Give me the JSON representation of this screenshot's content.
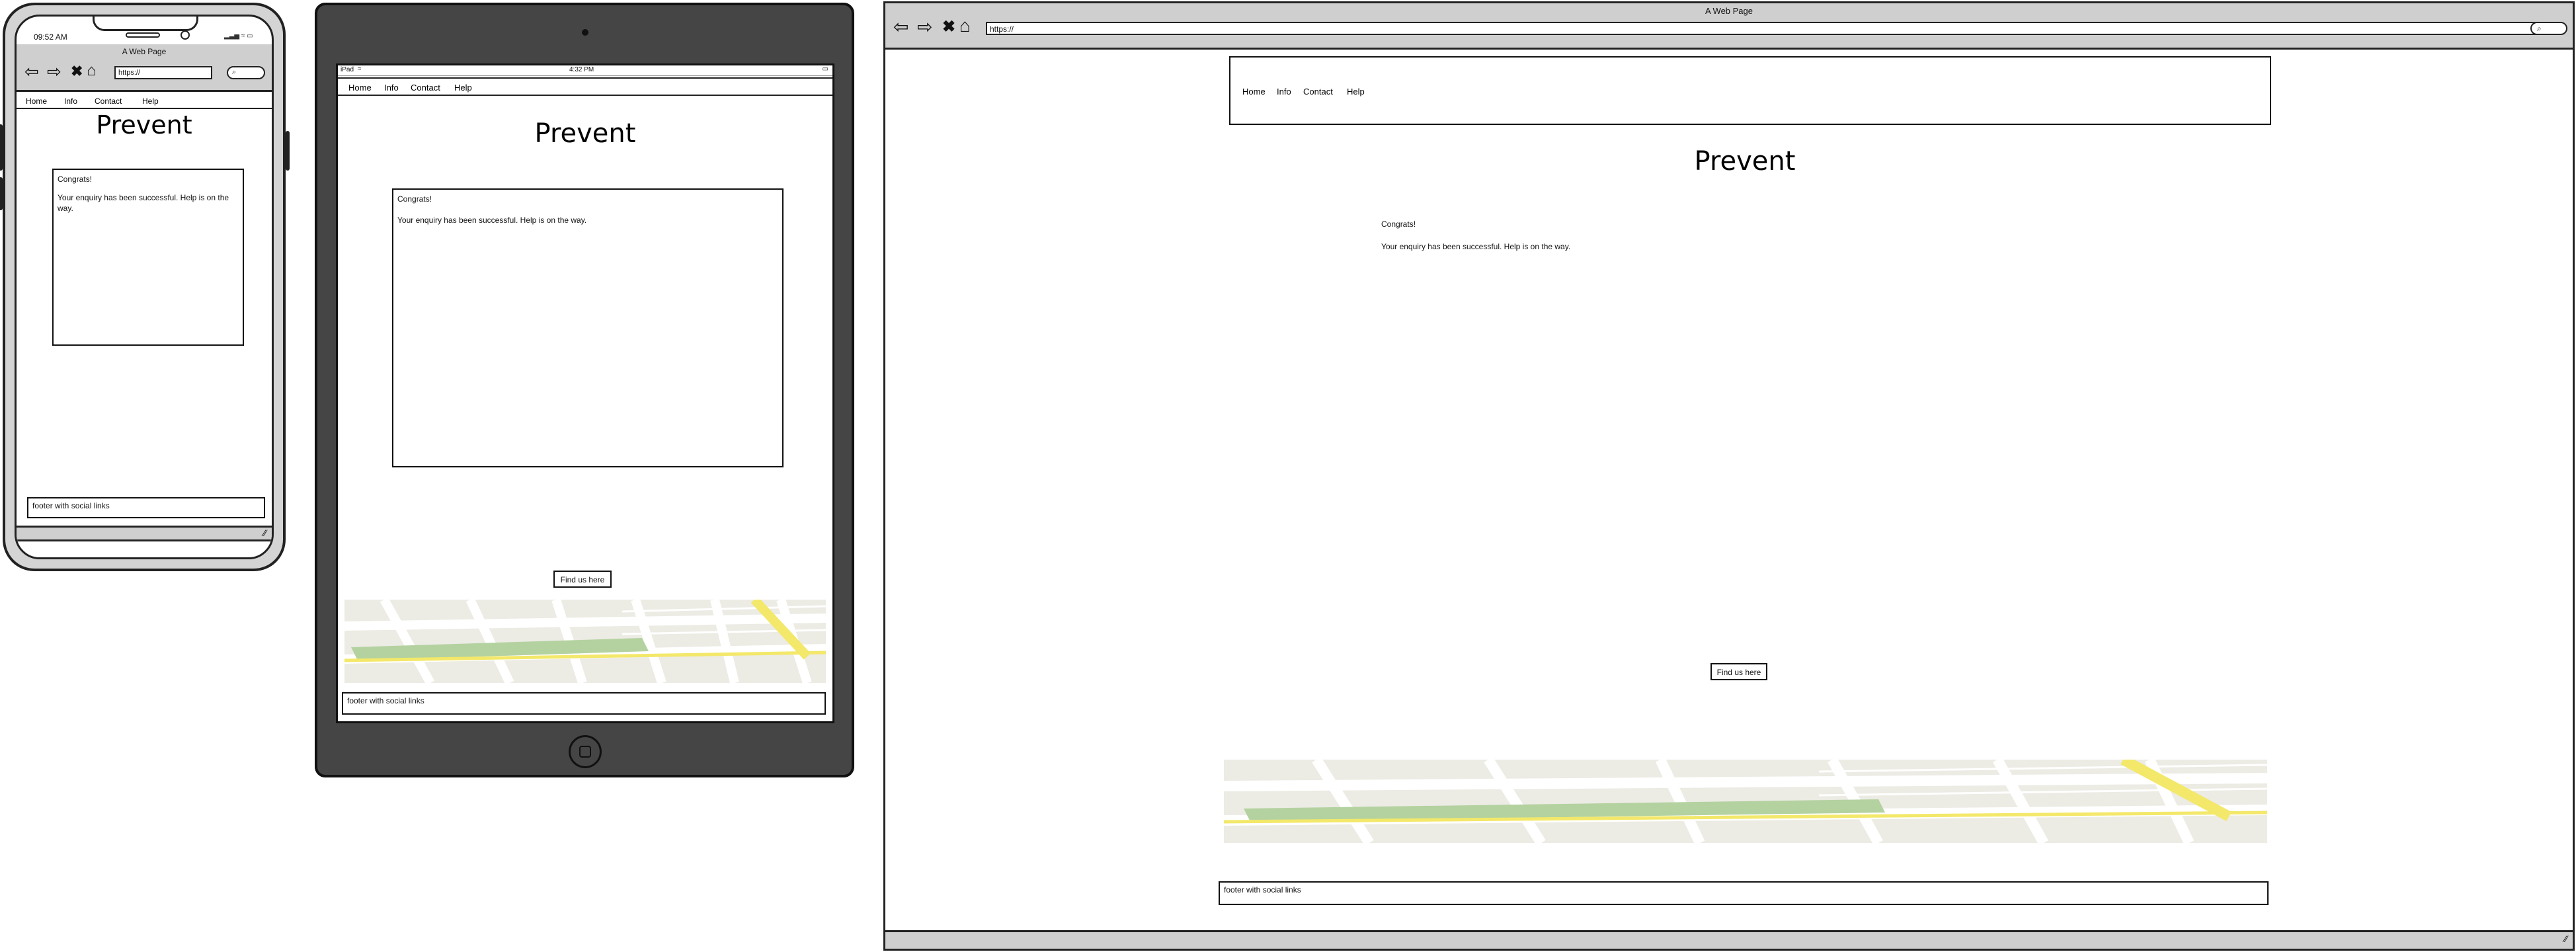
{
  "site": {
    "title": "Prevent",
    "nav": [
      "Home",
      "Info",
      "Contact",
      "Help"
    ],
    "notice_title": "Congrats!",
    "notice_body": "Your enquiry has been successful.  Help is on the way.",
    "find_us_button": "Find us here",
    "footer": "footer with social links"
  },
  "phone": {
    "status_time": "09:52 AM",
    "browser_title": "A Web Page",
    "url": "https://"
  },
  "tablet": {
    "status_left": "iPad",
    "status_time": "4:32 PM"
  },
  "desktop": {
    "browser_title": "A Web Page",
    "url": "https://"
  },
  "colors": {
    "device_bezel": "#454545",
    "chrome_gray": "#cfcfcf",
    "map_bg": "#ecebe4",
    "map_park": "#b4d2a0",
    "map_highway": "#f3e86a"
  },
  "icons": [
    "back-arrow-icon",
    "forward-arrow-icon",
    "close-icon",
    "home-icon",
    "search-icon",
    "resize-grip-icon",
    "wifi-icon",
    "battery-icon",
    "signal-icon",
    "home-button-icon"
  ]
}
